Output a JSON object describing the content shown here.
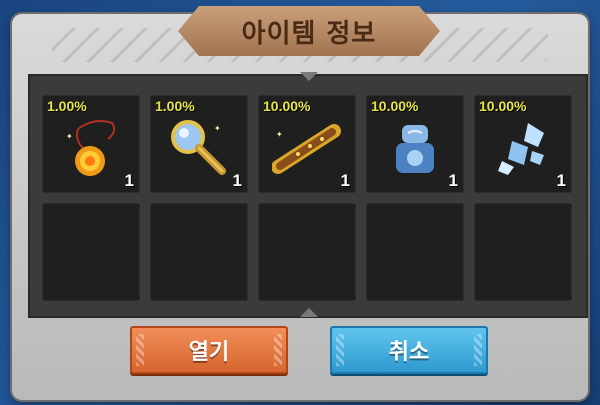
{
  "dialog": {
    "title": "아이템 정보"
  },
  "items": [
    {
      "rate": "1.00%",
      "qty": "1",
      "icon": "fire-medallion-icon"
    },
    {
      "rate": "1.00%",
      "qty": "1",
      "icon": "magnifying-glass-icon"
    },
    {
      "rate": "10.00%",
      "qty": "1",
      "icon": "golden-spyglass-icon"
    },
    {
      "rate": "10.00%",
      "qty": "1",
      "icon": "ice-stone-block-icon"
    },
    {
      "rate": "10.00%",
      "qty": "1",
      "icon": "ice-shard-icon"
    }
  ],
  "buttons": {
    "open_label": "열기",
    "cancel_label": "취소"
  },
  "colors": {
    "rate": "#e6e64a",
    "open_button": "#e9773f",
    "cancel_button": "#41b1e2",
    "title_plate": "#b88a62"
  }
}
